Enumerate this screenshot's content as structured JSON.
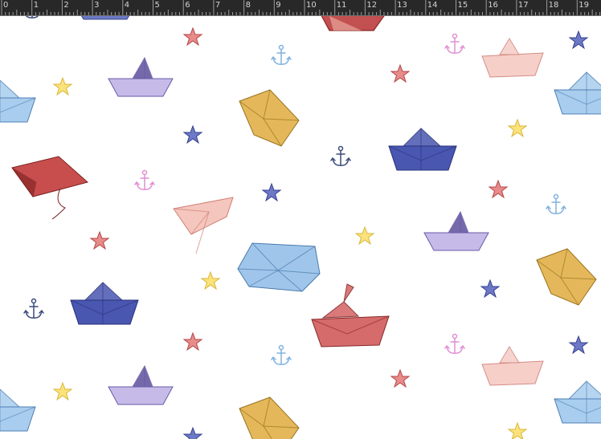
{
  "ruler": {
    "unit_labels": [
      "0",
      "1",
      "2",
      "3",
      "4",
      "5",
      "6",
      "7",
      "8",
      "9",
      "10",
      "11",
      "12",
      "13",
      "14",
      "15",
      "16",
      "17",
      "18",
      "19"
    ],
    "background": "#282828",
    "tick_color": "#9a9a9a",
    "label_color": "#d4d4d4"
  },
  "pattern": {
    "background": "#ffffff",
    "palette": {
      "red": "#b73a3a",
      "pink": "#f2b7b0",
      "navy": "#34408f",
      "lavender": "#a99ad6",
      "sky": "#7fb2df",
      "mustard": "#d9a63a",
      "yellow": "#f5d766",
      "lilac": "#e08fd4",
      "slate": "#3c4a7a"
    }
  }
}
